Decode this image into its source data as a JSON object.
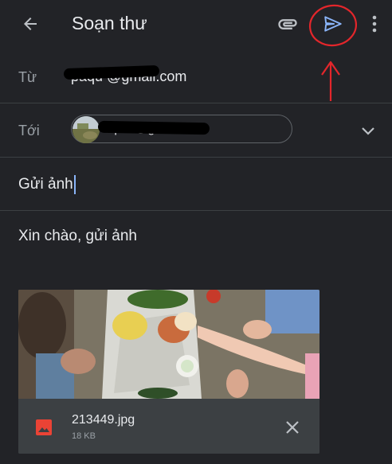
{
  "topbar": {
    "title": "Soạn thư",
    "icons": {
      "back": "arrow-back-icon",
      "attach": "paperclip-icon",
      "send": "send-icon",
      "more": "more-vert-icon"
    }
  },
  "from": {
    "label": "Từ",
    "value": "paqu           @gmail.com"
  },
  "to": {
    "label": "Tới",
    "recipient": "qu            5@gmail.com"
  },
  "subject": {
    "value": "Gửi ảnh"
  },
  "body": {
    "text": "Xin chào, gửi ảnh"
  },
  "attachment": {
    "filename": "213449.jpg",
    "size": "18 KB"
  },
  "colors": {
    "background": "#222327",
    "send_accent": "#8ab4f8",
    "annotation": "#e3262b",
    "attachment_icon": "#ea4335"
  }
}
